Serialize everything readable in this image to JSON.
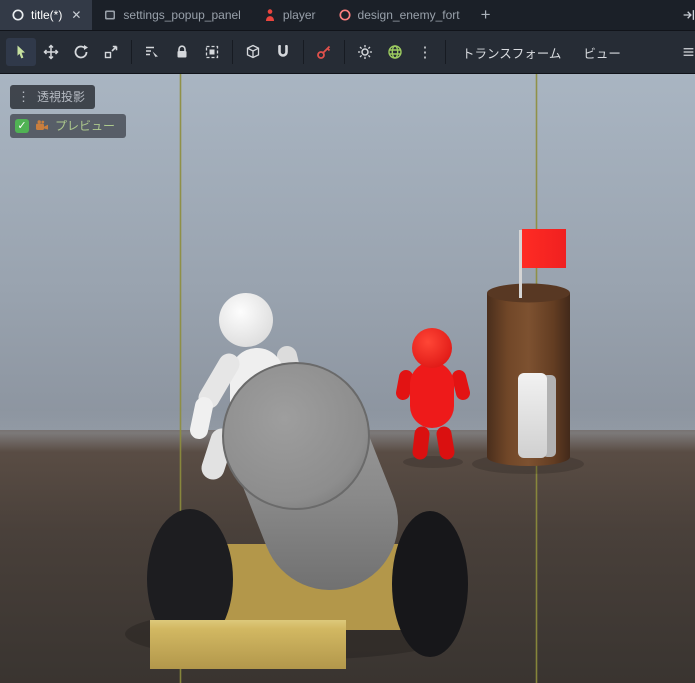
{
  "tabbar": {
    "tabs": [
      {
        "label": "title(*)",
        "active": true
      },
      {
        "label": "settings_popup_panel",
        "active": false
      },
      {
        "label": "player",
        "active": false
      },
      {
        "label": "design_enemy_fort",
        "active": false
      }
    ],
    "close_glyph": "✕",
    "add_glyph": "+"
  },
  "toolbar": {
    "kebab_glyph": "⋮",
    "menus": [
      {
        "label": "トランスフォーム"
      },
      {
        "label": "ビュー"
      }
    ]
  },
  "viewport": {
    "menu_glyph": "⋮",
    "projection_label": "透視投影",
    "preview_check_glyph": "✓",
    "preview_label": "プレビュー"
  },
  "scene": {
    "sky_top": "#a9b5c2",
    "sky_horizon": "#8b939e",
    "ground_top": "#5e5047",
    "ground_bottom": "#393430",
    "grid_line": "#8e8e3c",
    "cannon_gray": "#8a8a8a",
    "wheel": "#1d1d20",
    "carriage_yellow": "#b3974a",
    "base_yellow": "#d2b862",
    "figure_white": "#efefef",
    "figure_red": "#ee1a1a",
    "tower_brown": "#7d5130",
    "flag_red": "#f02020",
    "pole": "#d5d5d5",
    "door_white": "#f2f2f2"
  }
}
